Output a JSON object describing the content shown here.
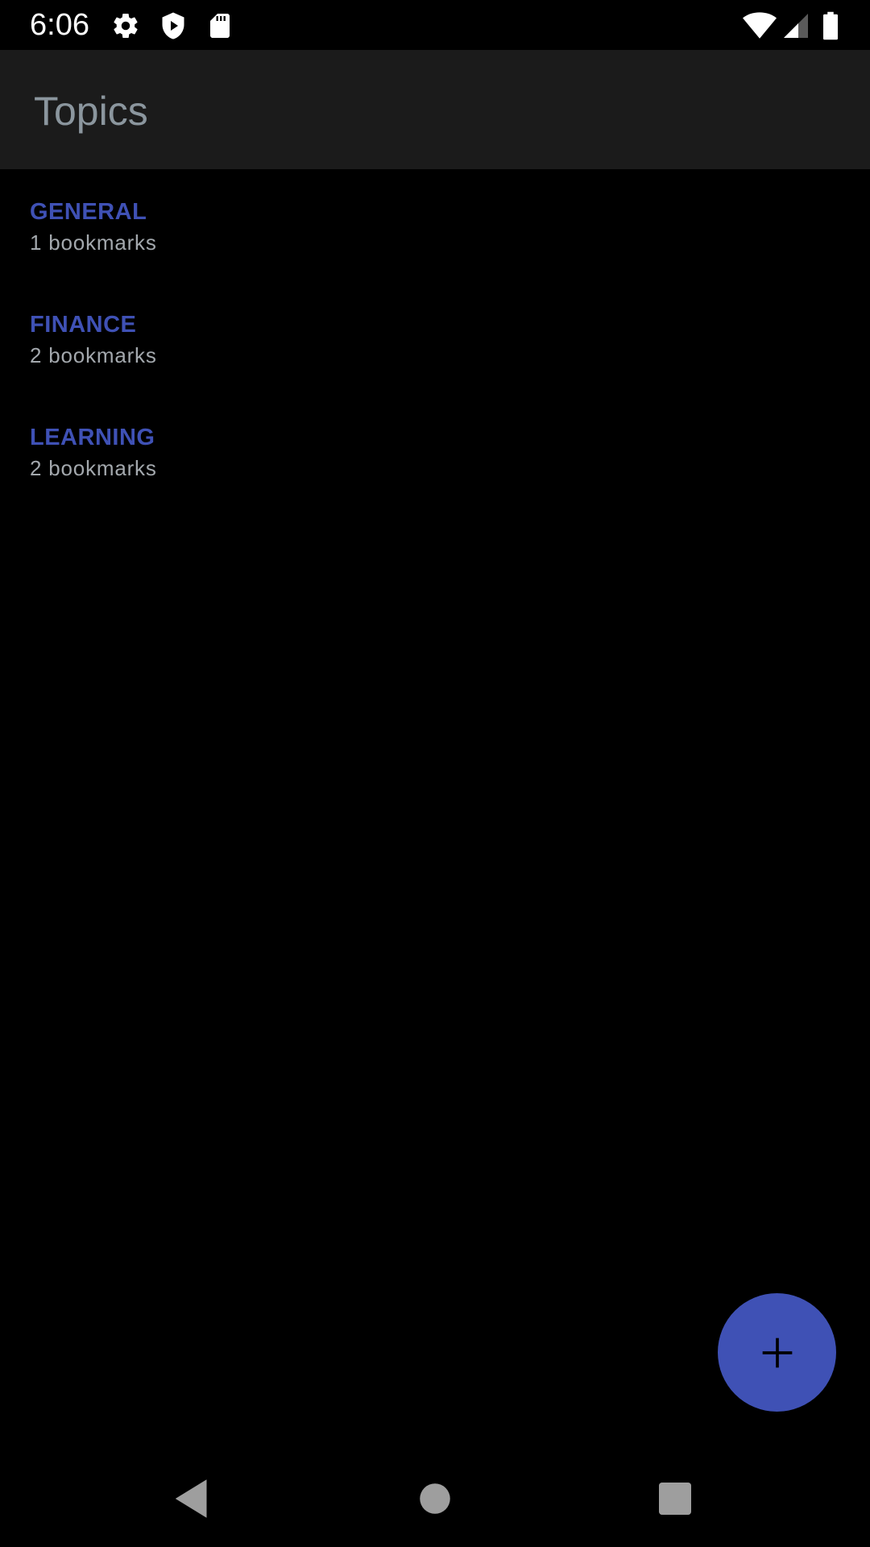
{
  "status_bar": {
    "time": "6:06",
    "icons": [
      "gear-icon",
      "shield-play-icon",
      "sd-card-icon",
      "wifi-icon",
      "cell-signal-icon",
      "battery-icon"
    ]
  },
  "app_bar": {
    "title": "Topics"
  },
  "topics": [
    {
      "name": "GENERAL",
      "count": "1 bookmarks"
    },
    {
      "name": "FINANCE",
      "count": "2 bookmarks"
    },
    {
      "name": "LEARNING",
      "count": "2 bookmarks"
    }
  ],
  "fab": {
    "icon": "plus-icon"
  },
  "nav_bar": {
    "icons": [
      "back-icon",
      "home-icon",
      "recents-icon"
    ]
  },
  "colors": {
    "accent": "#3f51b5",
    "topic_name": "#3f51b5",
    "app_bar_bg": "#1b1b1b",
    "title_text": "#8b969e",
    "secondary_text": "#a3a8ad",
    "background": "#000000"
  }
}
